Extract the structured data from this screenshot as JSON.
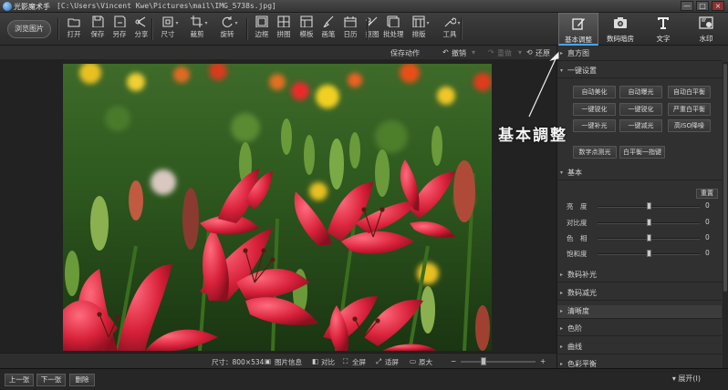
{
  "window": {
    "app_name": "光影魔术手",
    "file_path": "[C:\\Users\\Vincent Kwe\\Pictures\\mail\\IMG_5738s.jpg]",
    "controls": [
      "—",
      "□",
      "×"
    ]
  },
  "toolbar": {
    "browse_label": "浏览图片",
    "tools": [
      {
        "label": "打开",
        "icon": "open-icon"
      },
      {
        "label": "保存",
        "icon": "save-icon"
      },
      {
        "label": "另存",
        "icon": "save-as-icon"
      },
      {
        "label": "分享",
        "icon": "share-icon"
      },
      {
        "label": "尺寸",
        "icon": "resize-icon"
      },
      {
        "label": "裁剪",
        "icon": "crop-icon"
      },
      {
        "label": "旋转",
        "icon": "rotate-icon"
      },
      {
        "label": "边框",
        "icon": "border-icon"
      },
      {
        "label": "拼图",
        "icon": "collage-icon"
      },
      {
        "label": "模板",
        "icon": "template-icon"
      },
      {
        "label": "画笔",
        "icon": "brush-icon"
      },
      {
        "label": "日历",
        "icon": "calendar-icon"
      },
      {
        "label": "抠图",
        "icon": "cutout-icon"
      },
      {
        "label": "批处理",
        "icon": "batch-icon"
      },
      {
        "label": "排版",
        "icon": "layout-icon"
      },
      {
        "label": "工具",
        "icon": "tools-icon"
      }
    ],
    "right_tabs": [
      {
        "label": "基本调整",
        "icon": "edit-icon",
        "active": true
      },
      {
        "label": "数码暗房",
        "icon": "camera-icon",
        "active": false
      },
      {
        "label": "文字",
        "icon": "text-icon",
        "active": false
      },
      {
        "label": "水印",
        "icon": "watermark-icon",
        "active": false
      }
    ]
  },
  "subbar": {
    "save_action": "保存动作",
    "undo": "撤销",
    "redo": "重做",
    "restore": "还原"
  },
  "statusbar": {
    "size": "尺寸：800×534",
    "info": "图片信息",
    "compare": "对比",
    "fullscreen": "全屏",
    "fit": "适屏",
    "original": "原大"
  },
  "bottombar": {
    "prev": "上一张",
    "next": "下一张",
    "delete": "删除",
    "expand": "展开(I)"
  },
  "right_panel": {
    "histogram": "直方图",
    "one_click_title": "一键设置",
    "one_click_buttons": [
      "自动美化",
      "自动曝光",
      "自动白平衡",
      "一键锐化",
      "一键锐化",
      "严重白平衡",
      "一键补光",
      "一键减光",
      "高ISO降噪"
    ],
    "extra_buttons": [
      "数字点测光",
      "白平衡一指键"
    ],
    "basic_title": "基本",
    "reset_label": "重置",
    "sliders": [
      {
        "label": "亮　度",
        "value": "0",
        "level": 0.5
      },
      {
        "label": "对比度",
        "value": "0",
        "level": 0.5
      },
      {
        "label": "色　相",
        "value": "0",
        "level": 0.5
      },
      {
        "label": "饱和度",
        "value": "0",
        "level": 0.5
      }
    ],
    "sections": [
      "数码补光",
      "数码减光",
      "清晰度",
      "色阶",
      "曲线",
      "色彩平衡"
    ],
    "highlighted_section": "清晰度"
  },
  "annotation": {
    "text": "基本調整"
  },
  "colors": {
    "accent": "#4aa3ff",
    "flower_red": "#d8213a",
    "foliage": "#2f5a1f"
  }
}
